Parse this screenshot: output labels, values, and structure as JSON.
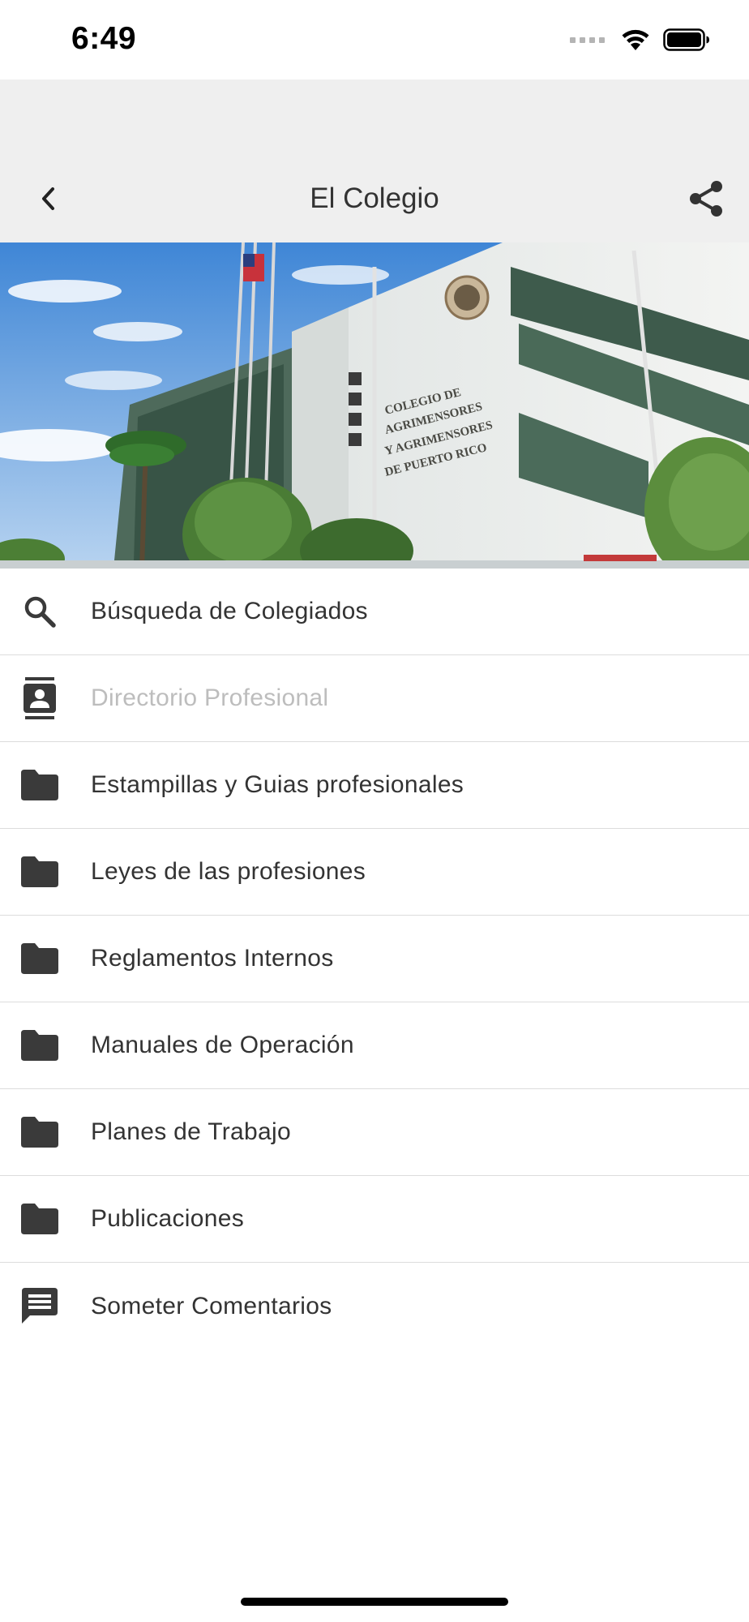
{
  "status_bar": {
    "time": "6:49",
    "icons": [
      "signal-icon",
      "wifi-icon",
      "battery-icon"
    ]
  },
  "nav": {
    "title": "El Colegio",
    "back_icon": "chevron-left-icon",
    "share_icon": "share-icon"
  },
  "hero": {
    "image": "building-photo",
    "sign_lines": [
      "COLEGIO DE",
      "AGRIMENSORES",
      "Y AGRIMENSORES",
      "DE PUERTO RICO"
    ]
  },
  "menu": {
    "items": [
      {
        "label": "Búsqueda de Colegiados",
        "icon": "search-icon",
        "enabled": true
      },
      {
        "label": "Directorio Profesional",
        "icon": "contacts-icon",
        "enabled": false
      },
      {
        "label": "Estampillas y Guias profesionales",
        "icon": "folder-icon",
        "enabled": true
      },
      {
        "label": "Leyes de las profesiones",
        "icon": "folder-icon",
        "enabled": true
      },
      {
        "label": "Reglamentos Internos",
        "icon": "folder-icon",
        "enabled": true
      },
      {
        "label": "Manuales de Operación",
        "icon": "folder-icon",
        "enabled": true
      },
      {
        "label": "Planes de Trabajo",
        "icon": "folder-icon",
        "enabled": true
      },
      {
        "label": "Publicaciones",
        "icon": "folder-icon",
        "enabled": true
      },
      {
        "label": "Someter Comentarios",
        "icon": "comment-icon",
        "enabled": true
      }
    ]
  },
  "colors": {
    "nav_background": "#efefef",
    "text": "#333333",
    "disabled_text": "#bdbdbd",
    "icon": "#3a3a3a",
    "divider": "#dcdcdc"
  }
}
